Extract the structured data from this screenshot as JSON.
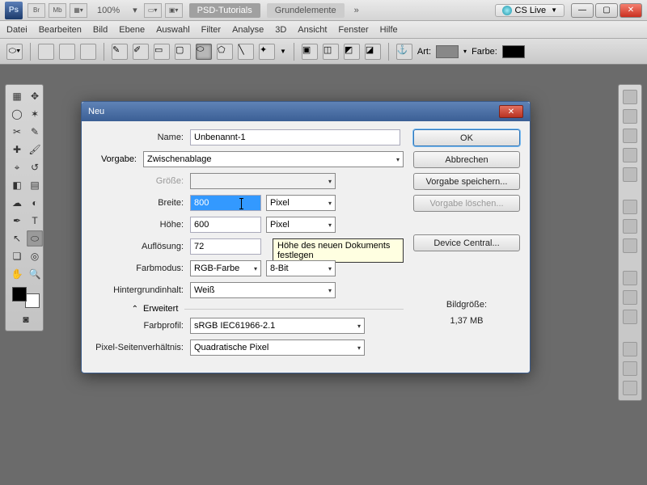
{
  "topbar": {
    "ps": "Ps",
    "br": "Br",
    "mb": "Mb",
    "zoom": "100%",
    "tab_active": "PSD-Tutorials",
    "tab_inactive": "Grundelemente",
    "cslive": "CS Live"
  },
  "menu": [
    "Datei",
    "Bearbeiten",
    "Bild",
    "Ebene",
    "Auswahl",
    "Filter",
    "Analyse",
    "3D",
    "Ansicht",
    "Fenster",
    "Hilfe"
  ],
  "options": {
    "art": "Art:",
    "farbe": "Farbe:"
  },
  "dialog": {
    "title": "Neu",
    "name_label": "Name:",
    "name_value": "Unbenannt-1",
    "vorgabe_label": "Vorgabe:",
    "vorgabe_value": "Zwischenablage",
    "groesse_label": "Größe:",
    "breite_label": "Breite:",
    "breite_value": "800",
    "breite_unit": "Pixel",
    "hoehe_label": "Höhe:",
    "hoehe_value": "600",
    "hoehe_unit": "Pixel",
    "aufl_label": "Auflösung:",
    "aufl_value": "72",
    "farbmodus_label": "Farbmodus:",
    "farbmodus_value": "RGB-Farbe",
    "farbmodus_bit": "8-Bit",
    "hginhalt_label": "Hintergrundinhalt:",
    "hginhalt_value": "Weiß",
    "erweitert": "Erweitert",
    "farbprofil_label": "Farbprofil:",
    "farbprofil_value": "sRGB IEC61966-2.1",
    "pixel_sv_label": "Pixel-Seitenverhältnis:",
    "pixel_sv_value": "Quadratische Pixel",
    "ok": "OK",
    "abbrechen": "Abbrechen",
    "vorgabe_speichern": "Vorgabe speichern...",
    "vorgabe_loeschen": "Vorgabe löschen...",
    "device_central": "Device Central...",
    "bildgroesse_label": "Bildgröße:",
    "bildgroesse_value": "1,37 MB",
    "tooltip": "Höhe des neuen Dokuments festlegen"
  }
}
